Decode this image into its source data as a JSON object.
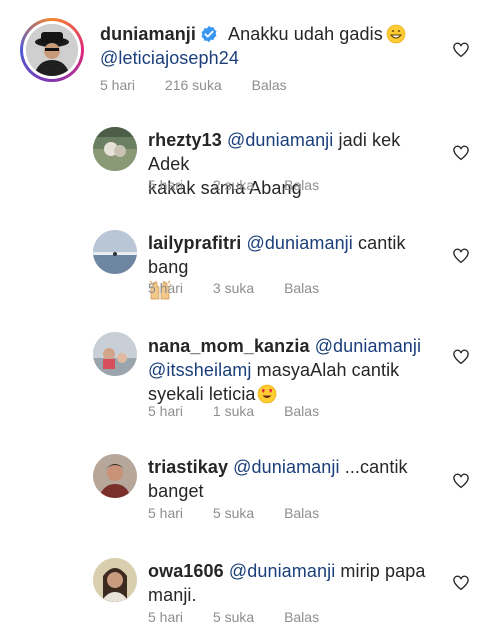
{
  "main": {
    "username": "duniamanji",
    "text": "Anakku udah gadis",
    "mention": "@leticiajoseph24",
    "time": "5 hari",
    "likes": "216 suka",
    "reply": "Balas"
  },
  "replies": [
    {
      "username": "rhezty13",
      "mention": "@duniamanji",
      "text_line1": "jadi kek Adek",
      "text_line2": "kakak sama Abang",
      "time": "5 hari",
      "likes": "2 suka",
      "reply": "Balas"
    },
    {
      "username": "lailyprafitri",
      "mention": "@duniamanji",
      "text_line1": "cantik bang",
      "text_line2": "",
      "time": "5 hari",
      "likes": "3 suka",
      "reply": "Balas"
    },
    {
      "username": "nana_mom_kanzia",
      "mention": "@duniamanji",
      "mention2": "@itssheilamj",
      "text_line1": "masyaAlah cantik",
      "text_line2": "syekali leticia",
      "time": "5 hari",
      "likes": "1 suka",
      "reply": "Balas"
    },
    {
      "username": "triastikay",
      "mention": "@duniamanji",
      "text_line1": "...cantik",
      "text_line2": "banget",
      "time": "5 hari",
      "likes": "5 suka",
      "reply": "Balas"
    },
    {
      "username": "owa1606",
      "mention": "@duniamanji",
      "text_line1": "mirip papa",
      "text_line2": "manji.",
      "time": "5 hari",
      "likes": "5 suka",
      "reply": "Balas"
    }
  ],
  "icons": {
    "heart": "heart-outline-icon",
    "verified": "verified-badge-icon",
    "grin_emoji": "grinning-face-icon",
    "raised_hands_emoji": "raising-hands-icon",
    "heart_eyes_emoji": "heart-eyes-face-icon"
  },
  "colors": {
    "text": "#262626",
    "meta": "#8e8e8e",
    "mention": "#1b3f7a",
    "verified": "#3897f0"
  }
}
